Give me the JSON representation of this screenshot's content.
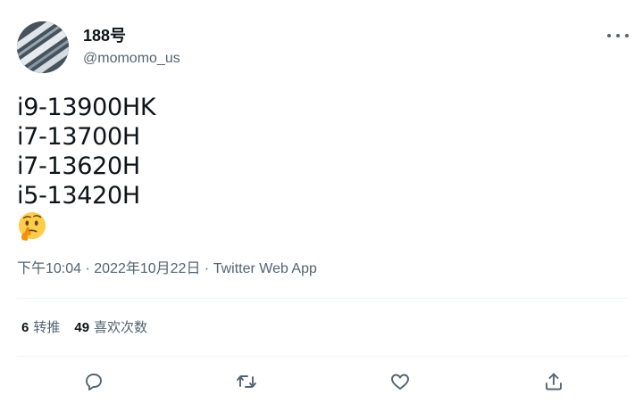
{
  "author": {
    "display_name": "188号",
    "handle": "@momomo_us"
  },
  "tweet": {
    "lines": [
      "i9-13900HK",
      "i7-13700H",
      "i7-13620H",
      "i5-13420H"
    ],
    "emoji": "thinking-face-emoji"
  },
  "meta": {
    "time": "下午10:04",
    "separator1": " · ",
    "date": "2022年10月22日",
    "separator2": " · ",
    "source": "Twitter Web App"
  },
  "stats": {
    "retweets_count": "6",
    "retweets_label": "转推",
    "likes_count": "49",
    "likes_label": "喜欢次数"
  },
  "icons": {
    "more": "more-icon",
    "reply": "reply-icon",
    "retweet": "retweet-icon",
    "like": "like-icon",
    "share": "share-icon"
  },
  "colors": {
    "text_primary": "#0f1419",
    "text_secondary": "#536471",
    "divider": "#eff3f4"
  }
}
